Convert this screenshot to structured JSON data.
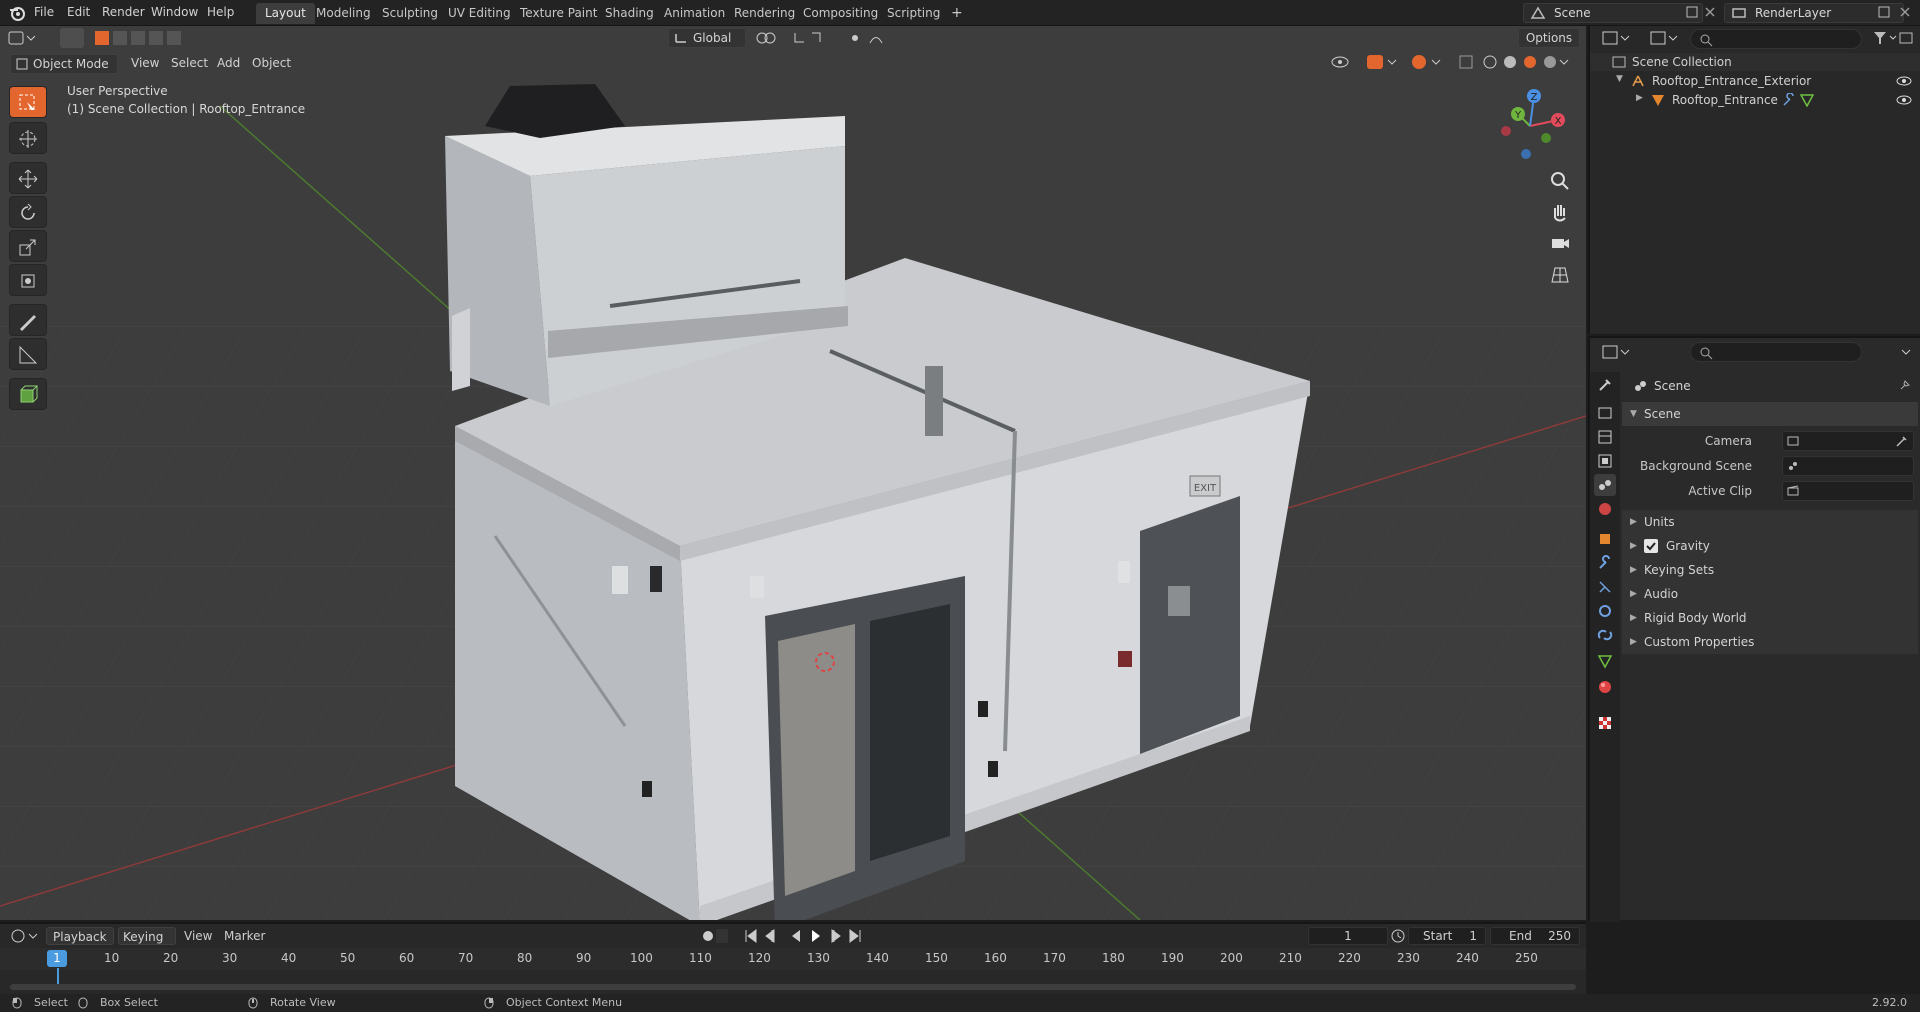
{
  "topbar": {
    "menus": [
      "File",
      "Edit",
      "Render",
      "Window",
      "Help"
    ],
    "workspaces": [
      "Layout",
      "Modeling",
      "Sculpting",
      "UV Editing",
      "Texture Paint",
      "Shading",
      "Animation",
      "Rendering",
      "Compositing",
      "Scripting"
    ],
    "add_tab_label": "+",
    "scene_name": "Scene",
    "view_layer": "RenderLayer"
  },
  "toolbar": {
    "transform_orientation": "Global",
    "options_label": "Options"
  },
  "viewport": {
    "mode": "Object Mode",
    "menus": [
      "View",
      "Select",
      "Add",
      "Object"
    ],
    "overlay_title": "User Perspective",
    "overlay_subtitle": "(1) Scene Collection | Rooftop_Entrance",
    "gizmo_x": "X",
    "gizmo_y": "Y",
    "gizmo_z": "Z",
    "exit_sign": "EXIT"
  },
  "outliner": {
    "root": "Scene Collection",
    "items": [
      {
        "label": "Rooftop_Entrance_Exterior"
      },
      {
        "label": "Rooftop_Entrance"
      }
    ]
  },
  "properties": {
    "header": "Scene",
    "panel_title": "Scene",
    "fields": [
      {
        "label": "Camera"
      },
      {
        "label": "Background Scene"
      },
      {
        "label": "Active Clip"
      }
    ],
    "sections": [
      "Units",
      "Gravity",
      "Keying Sets",
      "Audio",
      "Rigid Body World",
      "Custom Properties"
    ]
  },
  "timeline": {
    "menus": [
      "Playback",
      "Keying",
      "View",
      "Marker"
    ],
    "current_frame": "1",
    "start_label": "Start",
    "start_value": "1",
    "end_label": "End",
    "end_value": "250",
    "ruler": [
      "10",
      "20",
      "30",
      "40",
      "50",
      "60",
      "70",
      "80",
      "90",
      "100",
      "110",
      "120",
      "130",
      "140",
      "150",
      "160",
      "170",
      "180",
      "190",
      "200",
      "210",
      "220",
      "230",
      "240",
      "250"
    ],
    "playhead_label": "1"
  },
  "statusbar": {
    "items": [
      "Select",
      "Box Select",
      "Rotate View",
      "Object Context Menu"
    ],
    "version": "2.92.0"
  },
  "colors": {
    "accent": "#e3662e",
    "active_tab": "#3d3d3d"
  }
}
